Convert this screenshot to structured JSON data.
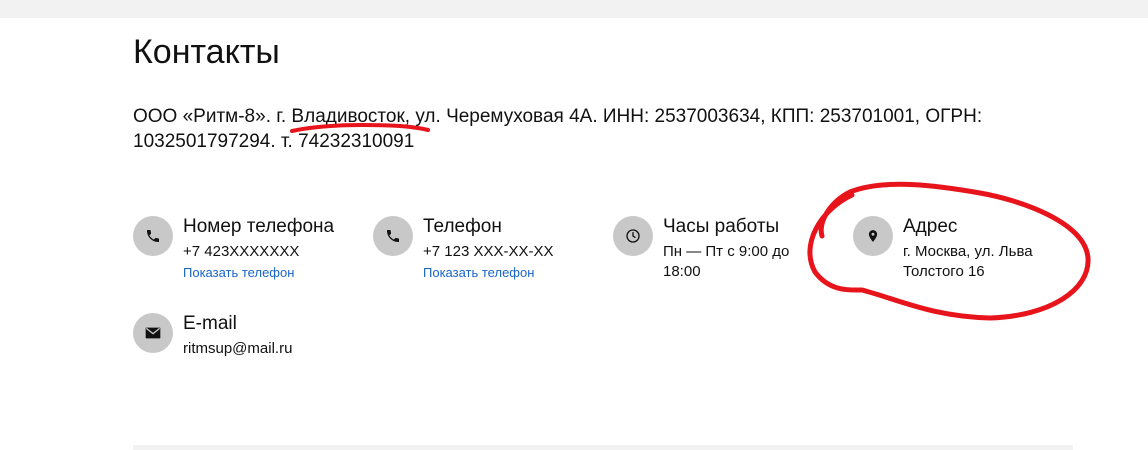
{
  "page": {
    "title": "Контакты",
    "company_prefix": "ООО «Ритм-8». ",
    "company_city": "г. Владивосток",
    "company_rest": ", ул. Черемуховая 4А. ИНН: 2537003634, КПП: 253701001, ОГРН: 1032501797294. т. 74232310091"
  },
  "contacts": [
    {
      "icon": "phone-icon",
      "title": "Номер телефона",
      "value": "+7 423XXXXXXX",
      "link": "Показать телефон"
    },
    {
      "icon": "phone-icon",
      "title": "Телефон",
      "value": "+7 123 XXX-XX-XX",
      "link": "Показать телефон"
    },
    {
      "icon": "clock-icon",
      "title": "Часы работы",
      "value": "Пн — Пт с 9:00 до 18:00"
    },
    {
      "icon": "location-pin-icon",
      "title": "Адрес",
      "value": "г. Москва, ул. Льва Толстого 16"
    },
    {
      "icon": "envelope-icon",
      "title": "E-mail",
      "value": "ritmsup@mail.ru"
    }
  ],
  "colors": {
    "link": "#1b64c8",
    "icon_bg": "#c8c8c8",
    "annotation": "#e8141c"
  }
}
